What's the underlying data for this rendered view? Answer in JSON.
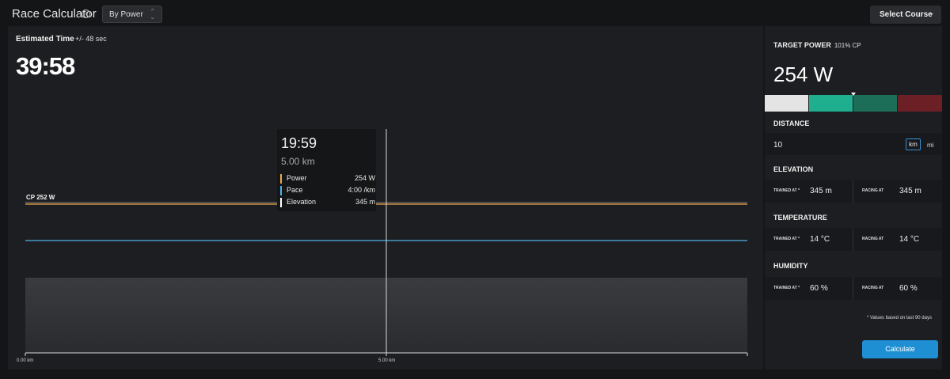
{
  "header": {
    "title": "Race Calculator",
    "info_icon": "info-icon",
    "mode_select": {
      "value": "By Power"
    },
    "select_course_label": "Select Course"
  },
  "estimate": {
    "label": "Estimated Time",
    "margin": "+/- 48 sec",
    "time": "39:58"
  },
  "chart_data": {
    "type": "line",
    "x": [
      0,
      10
    ],
    "x_unit": "km",
    "tick_labels": [
      "0.00 km",
      "5.00 km"
    ],
    "annotation": "CP 252 W",
    "cursor": {
      "time": "19:59",
      "distance": "5.00 km"
    },
    "series": [
      {
        "name": "Power",
        "color": "#f0a94b",
        "values": [
          254,
          254
        ],
        "display": "254 W"
      },
      {
        "name": "Pace",
        "color": "#4fb3e8",
        "values": [
          240,
          240
        ],
        "display": "4:00 /km"
      },
      {
        "name": "Elevation",
        "color": "#ffffff",
        "values": [
          345,
          345
        ],
        "display": "345 m"
      }
    ]
  },
  "sidebar": {
    "target_power": {
      "title": "TARGET POWER",
      "sub": "101% CP",
      "value": "254 W"
    },
    "zones": [
      "#e4e4e4",
      "#1faf8e",
      "#1d6e58",
      "#6c1f25"
    ],
    "distance": {
      "title": "DISTANCE",
      "value": "10",
      "unit_km": "km",
      "unit_mi": "mi"
    },
    "elevation": {
      "title": "ELEVATION",
      "trained_label": "TRAINED AT *",
      "trained_value": "345",
      "racing_label": "RACING AT",
      "racing_value": "345",
      "unit": "m"
    },
    "temperature": {
      "title": "TEMPERATURE",
      "trained_label": "TRAINED AT *",
      "trained_value": "14",
      "racing_label": "RACING AT",
      "racing_value": "14",
      "unit": "°C"
    },
    "humidity": {
      "title": "HUMIDITY",
      "trained_label": "TRAINED AT *",
      "trained_value": "60",
      "racing_label": "RACING AT",
      "racing_value": "60",
      "unit": "%"
    },
    "note": "* Values based on last 90 days",
    "calculate_label": "Calculate"
  }
}
